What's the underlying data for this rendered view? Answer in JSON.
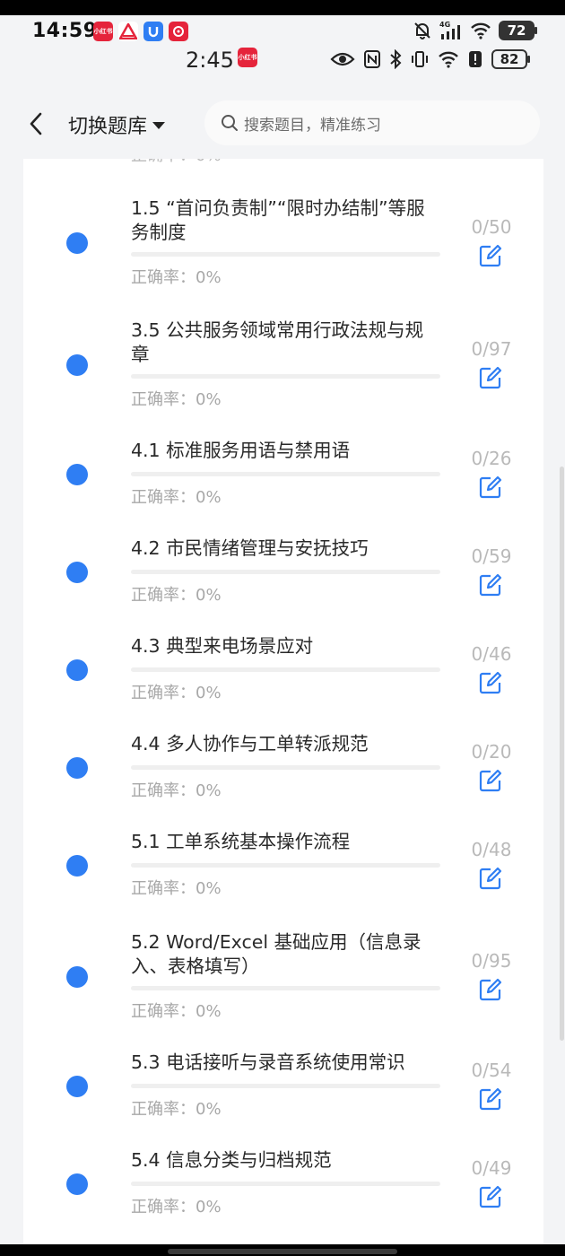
{
  "status_bar": {
    "time_primary": "14:59",
    "time_secondary": "2:45",
    "battery_primary": "72",
    "battery_secondary": "82",
    "network_label": "4G",
    "app_icon_label": "小红书"
  },
  "header": {
    "switch_label": "切换题库",
    "search_placeholder": "搜索题目，精准练习"
  },
  "list": {
    "partial_text": "正确率：0%",
    "items": [
      {
        "title": "1.5 “首问负责制”“限时办结制”等服务制度",
        "count": "0/50",
        "accuracy": "正确率：0%"
      },
      {
        "title": "3.5 公共服务领域常用行政法规与规章",
        "count": "0/97",
        "accuracy": "正确率：0%"
      },
      {
        "title": "4.1 标准服务用语与禁用语",
        "count": "0/26",
        "accuracy": "正确率：0%"
      },
      {
        "title": "4.2 市民情绪管理与安抚技巧",
        "count": "0/59",
        "accuracy": "正确率：0%"
      },
      {
        "title": "4.3 典型来电场景应对",
        "count": "0/46",
        "accuracy": "正确率：0%"
      },
      {
        "title": "4.4 多人协作与工单转派规范",
        "count": "0/20",
        "accuracy": "正确率：0%"
      },
      {
        "title": "5.1 工单系统基本操作流程",
        "count": "0/48",
        "accuracy": "正确率：0%"
      },
      {
        "title": "5.2 Word/Excel 基础应用（信息录入、表格填写）",
        "count": "0/95",
        "accuracy": "正确率：0%"
      },
      {
        "title": "5.3 电话接听与录音系统使用常识",
        "count": "0/54",
        "accuracy": "正确率：0%"
      },
      {
        "title": "5.4 信息分类与归档规范",
        "count": "0/49",
        "accuracy": "正确率：0%"
      }
    ]
  },
  "colors": {
    "dot": "#2f7ef3",
    "edit_icon": "#2f7ef3",
    "background": "#f3f4f6"
  }
}
